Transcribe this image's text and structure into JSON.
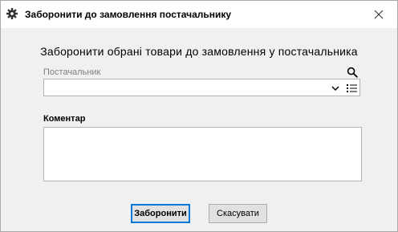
{
  "window": {
    "title": "Заборонити до замовлення постачальнику"
  },
  "dialog": {
    "heading": "Заборонити обрані товари до замовлення у постачальника",
    "supplier": {
      "label": "Постачальник",
      "value": ""
    },
    "comment": {
      "label": "Коментар",
      "value": ""
    }
  },
  "buttons": {
    "submit_label": "Заборонити",
    "cancel_label": "Скасувати"
  },
  "icons": {
    "title": "gear-icon",
    "close": "close-icon",
    "search": "search-icon",
    "dropdown": "chevron-down-icon",
    "list": "list-icon"
  },
  "colors": {
    "focus_border": "#0078d7",
    "placeholder_text": "#808080"
  }
}
